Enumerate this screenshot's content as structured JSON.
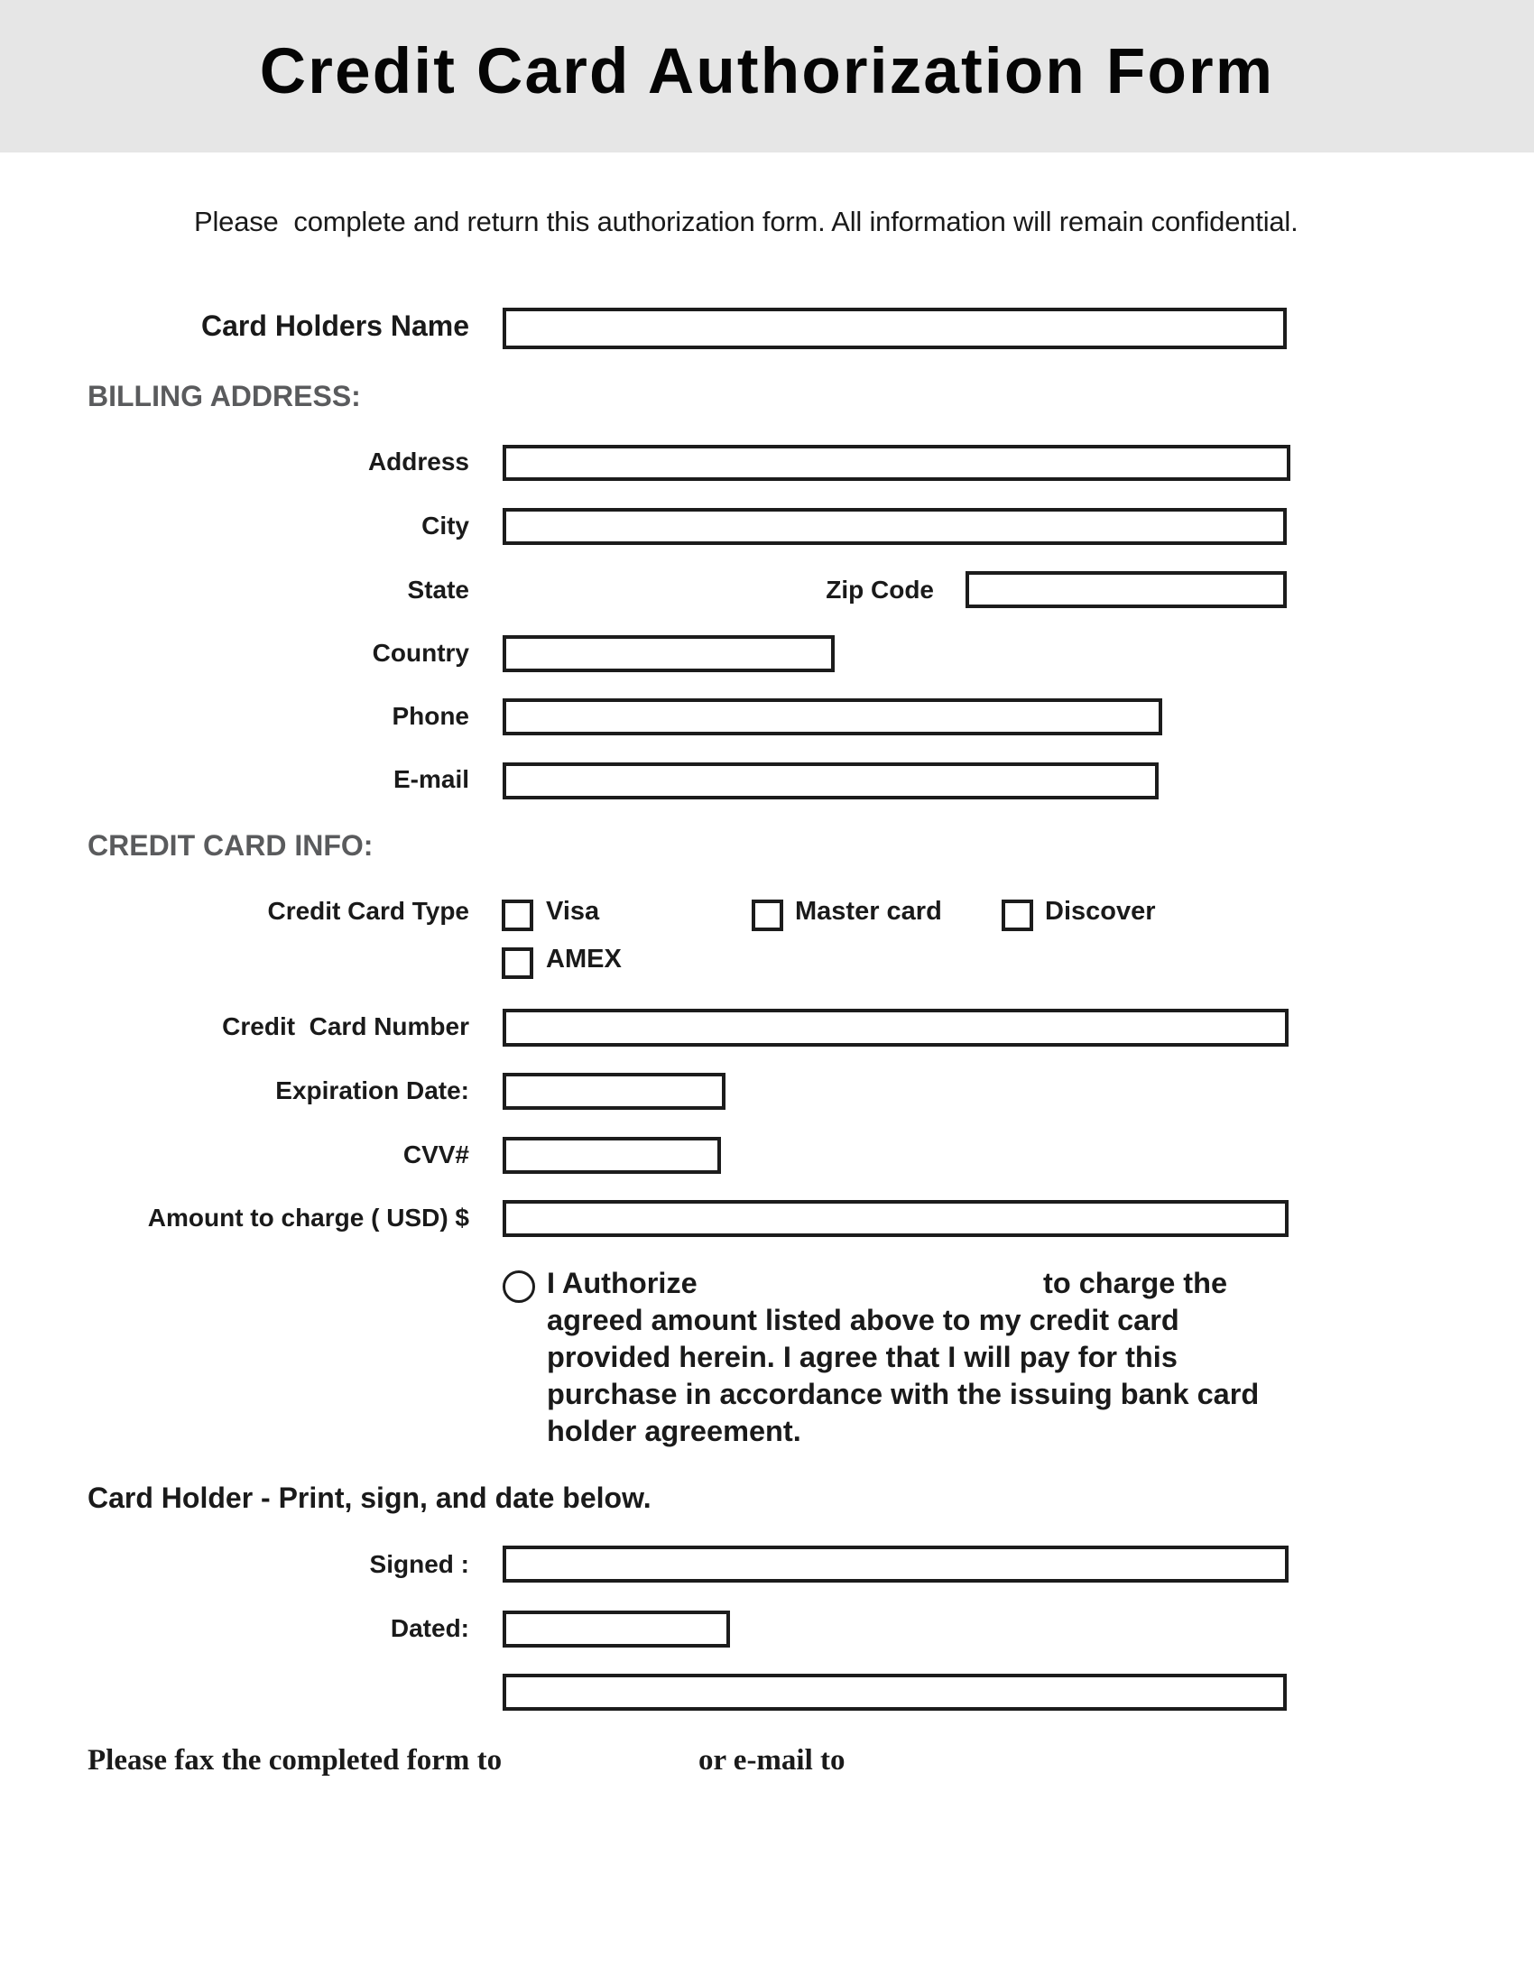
{
  "header": {
    "title": "Credit Card Authorization Form",
    "subtitle": "Please  complete and return this authorization form. All information will remain confidential.",
    "band_color": "#e6e6e6"
  },
  "card_holder_name": {
    "label": "Card Holders Name",
    "value": ""
  },
  "billing_address": {
    "heading": "BILLING ADDRESS:",
    "heading_color": "#5a5b5d",
    "address": {
      "label": "Address",
      "value": ""
    },
    "city": {
      "label": "City",
      "value": ""
    },
    "state": {
      "label": "State"
    },
    "zip": {
      "label": "Zip Code",
      "value": ""
    },
    "country": {
      "label": "Country",
      "value": ""
    },
    "phone": {
      "label": "Phone",
      "value": ""
    },
    "email": {
      "label": "E-mail",
      "value": ""
    }
  },
  "credit_card_info": {
    "heading": "CREDIT CARD INFO:",
    "card_type": {
      "label": "Credit Card Type",
      "options": [
        {
          "label": "Visa",
          "checked": false
        },
        {
          "label": "Master card",
          "checked": false
        },
        {
          "label": "Discover",
          "checked": false
        },
        {
          "label": "AMEX",
          "checked": false
        }
      ]
    },
    "card_number": {
      "label": "Credit  Card Number",
      "value": ""
    },
    "expiration": {
      "label": "Expiration Date:",
      "value": ""
    },
    "cvv": {
      "label": "CVV#",
      "value": ""
    },
    "amount": {
      "label": "Amount to charge ( USD) $",
      "value": ""
    }
  },
  "authorization": {
    "selected": false,
    "lines": [
      "I Authorize",
      "agreed amount listed above to my credit card",
      "provided herein. I agree that I will pay for this",
      "purchase in accordance with the issuing bank card",
      "holder agreement."
    ],
    "line1_right": "to charge the"
  },
  "signature_section": {
    "heading": "Card Holder - Print, sign, and date below.",
    "signed": {
      "label": "Signed :",
      "value": ""
    },
    "dated": {
      "label": "Dated:",
      "value": ""
    },
    "print_name": {
      "value": ""
    }
  },
  "footer": {
    "fax_text": "Please fax the completed form to",
    "email_text": "or e-mail to"
  }
}
